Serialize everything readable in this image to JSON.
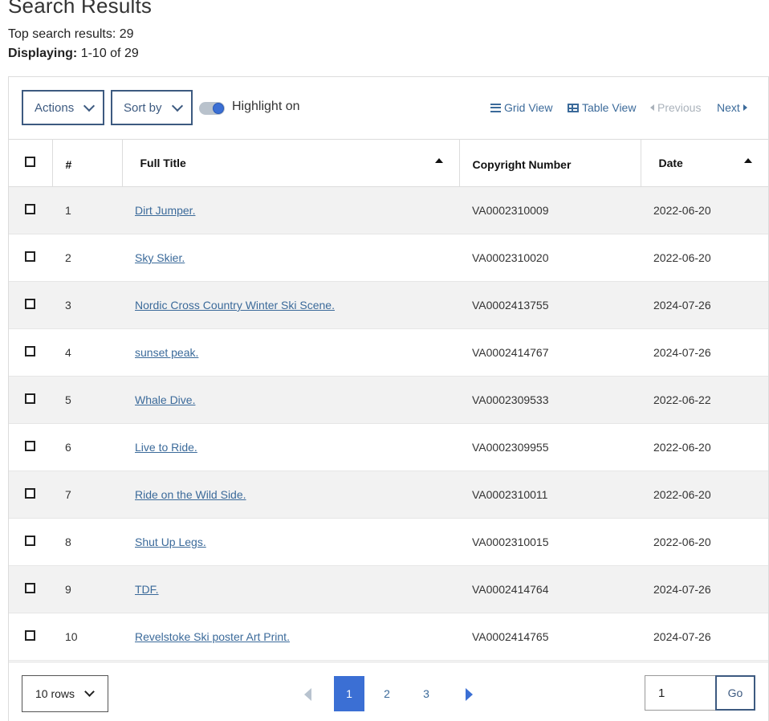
{
  "page": {
    "title": "Search Results",
    "summary": "Top search results: 29",
    "displaying_label": "Displaying:",
    "displaying_value": "1-10 of 29"
  },
  "toolbar": {
    "actions_label": "Actions",
    "sort_label": "Sort by",
    "highlight_label": "Highlight on",
    "highlight_on": true,
    "grid_view_label": "Grid View",
    "table_view_label": "Table View",
    "previous_label": "Previous",
    "next_label": "Next"
  },
  "table": {
    "headers": {
      "num": "#",
      "title": "Full Title",
      "copyright": "Copyright Number",
      "date": "Date"
    },
    "rows": [
      {
        "num": "1",
        "title": "Dirt Jumper.",
        "copyright": "VA0002310009",
        "date": "2022-06-20"
      },
      {
        "num": "2",
        "title": "Sky Skier.",
        "copyright": "VA0002310020",
        "date": "2022-06-20"
      },
      {
        "num": "3",
        "title": "Nordic Cross Country Winter Ski Scene.",
        "copyright": "VA0002413755",
        "date": "2024-07-26"
      },
      {
        "num": "4",
        "title": "sunset peak.",
        "copyright": "VA0002414767",
        "date": "2024-07-26"
      },
      {
        "num": "5",
        "title": "Whale Dive.",
        "copyright": "VA0002309533",
        "date": "2022-06-22"
      },
      {
        "num": "6",
        "title": "Live to Ride.",
        "copyright": "VA0002309955",
        "date": "2022-06-20"
      },
      {
        "num": "7",
        "title": "Ride on the Wild Side.",
        "copyright": "VA0002310011",
        "date": "2022-06-20"
      },
      {
        "num": "8",
        "title": "Shut Up Legs.",
        "copyright": "VA0002310015",
        "date": "2022-06-20"
      },
      {
        "num": "9",
        "title": "TDF.",
        "copyright": "VA0002414764",
        "date": "2024-07-26"
      },
      {
        "num": "10",
        "title": "Revelstoke Ski poster Art Print.",
        "copyright": "VA0002414765",
        "date": "2024-07-26"
      }
    ]
  },
  "footer": {
    "rows_per_page": "10 rows",
    "pages": [
      "1",
      "2",
      "3"
    ],
    "current_page": "1",
    "go_input_value": "1",
    "go_label": "Go"
  },
  "colors": {
    "accent": "#3b6fd4",
    "border_button": "#3d5a80",
    "link": "#3b6a9a"
  }
}
